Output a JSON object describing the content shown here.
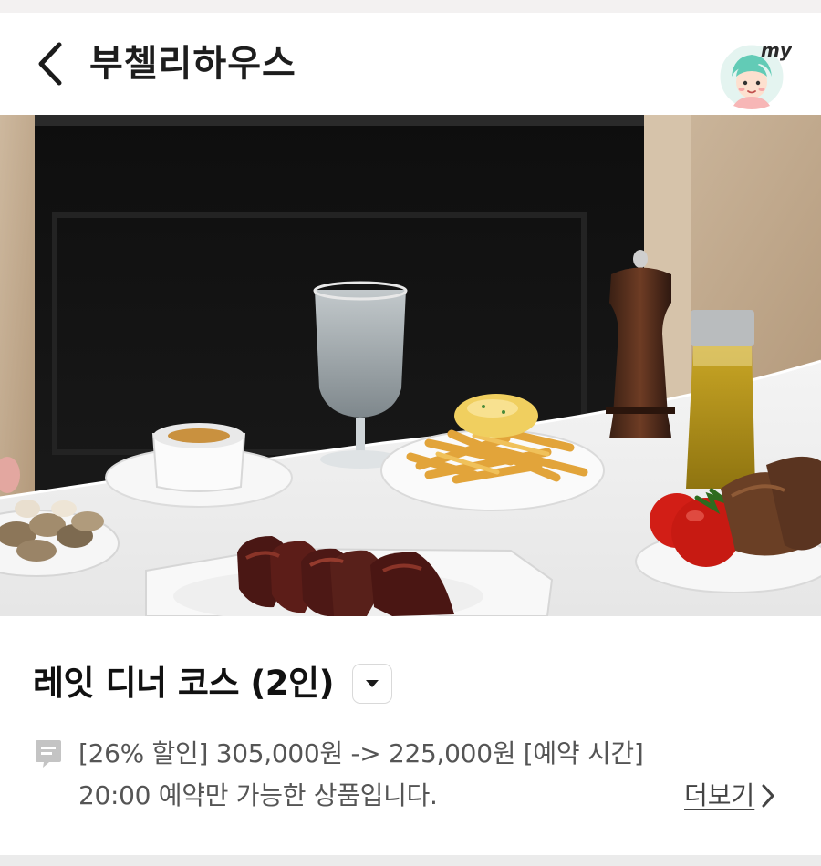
{
  "header": {
    "title": "부첼리하우스",
    "back_icon": "chevron-left-icon",
    "profile_badge": "my"
  },
  "hero": {
    "icon": "restaurant-photo"
  },
  "product": {
    "title": "레잇 디너 코스 (2인)",
    "dropdown_icon": "caret-down-icon",
    "description": "[26% 할인] 305,000원 -> 225,000원 [예약 시간] 20:00 예약만 가능한 상품입니다.",
    "more_label": "더보기",
    "more_icon": "chevron-right-icon"
  },
  "colors": {
    "accent": "#1b1b1b",
    "muted_text": "#555555",
    "avatar_bg": "#dff2ee",
    "avatar_hair": "#6fd0bd"
  }
}
